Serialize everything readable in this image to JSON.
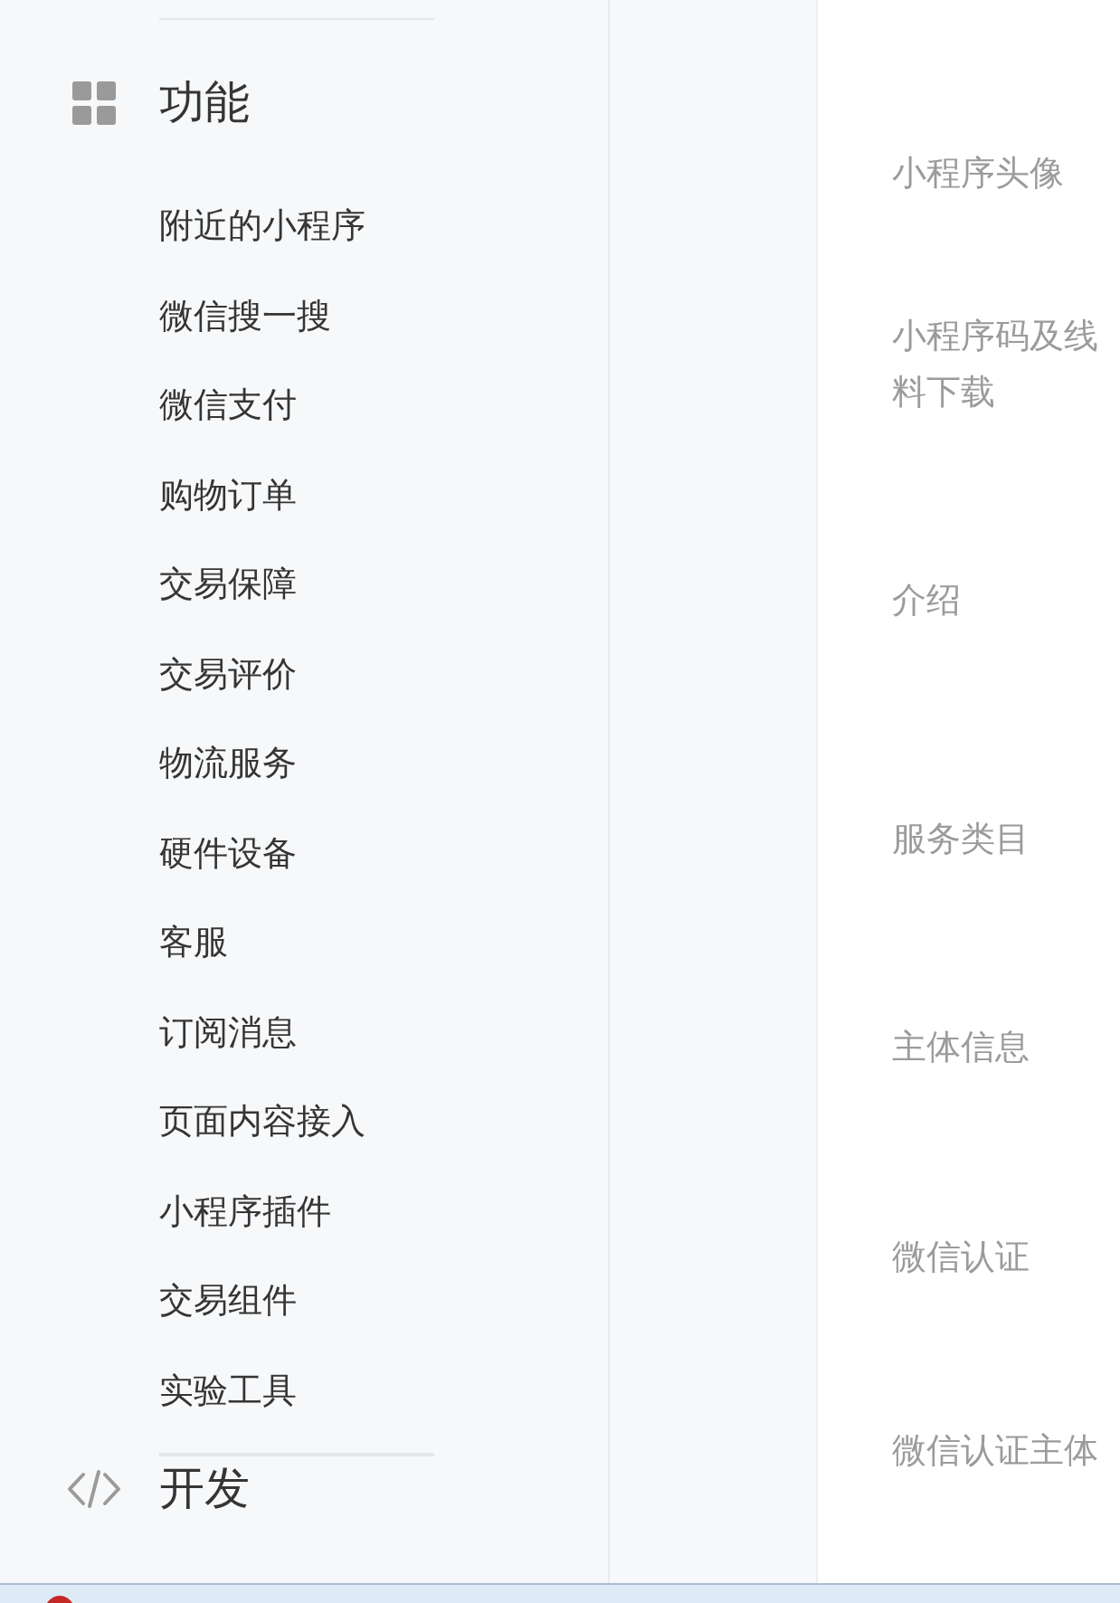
{
  "sidebar": {
    "groups": [
      {
        "title": "功能",
        "items": [
          {
            "label": "附近的小程序",
            "selected": false
          },
          {
            "label": "微信搜一搜",
            "selected": false
          },
          {
            "label": "微信支付",
            "selected": false
          },
          {
            "label": "购物订单",
            "selected": false
          },
          {
            "label": "交易保障",
            "selected": false
          },
          {
            "label": "交易评价",
            "selected": false
          },
          {
            "label": "物流服务",
            "selected": false
          },
          {
            "label": "硬件设备",
            "selected": false
          },
          {
            "label": "客服",
            "selected": false
          },
          {
            "label": "订阅消息",
            "selected": false
          },
          {
            "label": "页面内容接入",
            "selected": false
          },
          {
            "label": "小程序插件",
            "selected": false
          },
          {
            "label": "交易组件",
            "selected": false
          },
          {
            "label": "实验工具",
            "selected": false
          }
        ]
      },
      {
        "title": "开发"
      }
    ]
  },
  "detail": {
    "fields": [
      {
        "label": "小程序头像"
      },
      {
        "label": "小程序码及线料下载"
      },
      {
        "label": "介绍"
      },
      {
        "label": "服务类目"
      },
      {
        "label": "主体信息"
      },
      {
        "label": "微信认证"
      },
      {
        "label": "微信认证主体"
      }
    ]
  }
}
